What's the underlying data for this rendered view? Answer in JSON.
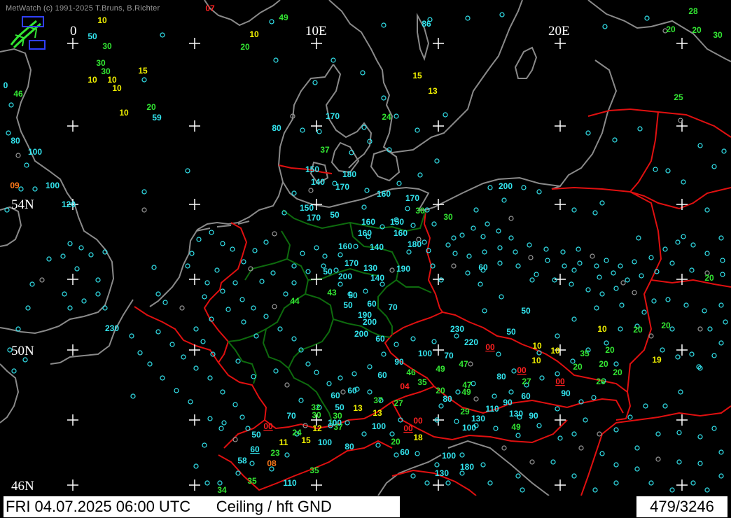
{
  "header": {
    "copyright": "MetWatch  (c) 1991-2025 T.Bruns, B.Richter"
  },
  "footer": {
    "datetime": "FRI 04.07.2025 06:00 UTC",
    "product": "Ceiling / hft GND",
    "count": "479/3246"
  },
  "colors": {
    "cyan": "#33e6f0",
    "green": "#33e633",
    "yellow": "#f0f000",
    "red": "#ff2020",
    "orange": "#ff7a1a",
    "border_red": "#e01010",
    "state_green": "#0e6b0e",
    "coast": "#8a8a8a"
  },
  "grid_labels": {
    "lon": [
      "0",
      "10E",
      "20E"
    ],
    "lat": [
      "54N",
      "50N",
      "46N"
    ]
  },
  "stations": [
    {
      "v": "07",
      "c": "red",
      "u": false
    },
    {
      "v": "49",
      "c": "green"
    },
    {
      "v": "10",
      "c": "yellow"
    },
    {
      "v": "86",
      "c": "cyan"
    },
    {
      "v": "28",
      "c": "green"
    },
    {
      "v": "50",
      "c": "cyan"
    },
    {
      "v": "30",
      "c": "green"
    },
    {
      "v": "10",
      "c": "yellow"
    },
    {
      "v": "20",
      "c": "green"
    },
    {
      "v": "20",
      "c": "green"
    },
    {
      "v": "20",
      "c": "green"
    },
    {
      "v": "30",
      "c": "green"
    },
    {
      "v": "30",
      "c": "green"
    },
    {
      "v": "30",
      "c": "green"
    },
    {
      "v": "15",
      "c": "yellow"
    },
    {
      "v": "10",
      "c": "yellow"
    },
    {
      "v": "10",
      "c": "yellow"
    },
    {
      "v": "10",
      "c": "yellow"
    },
    {
      "v": "15",
      "c": "yellow"
    },
    {
      "v": "13",
      "c": "yellow"
    },
    {
      "v": "0",
      "c": "cyan"
    },
    {
      "v": "46",
      "c": "green"
    },
    {
      "v": "25",
      "c": "green"
    },
    {
      "v": "20",
      "c": "green"
    },
    {
      "v": "10",
      "c": "yellow"
    },
    {
      "v": "59",
      "c": "cyan"
    },
    {
      "v": "170",
      "c": "cyan"
    },
    {
      "v": "24",
      "c": "green"
    },
    {
      "v": "80",
      "c": "cyan"
    },
    {
      "v": "80",
      "c": "cyan"
    },
    {
      "v": "100",
      "c": "cyan"
    },
    {
      "v": "37",
      "c": "green"
    },
    {
      "v": "150",
      "c": "cyan"
    },
    {
      "v": "180",
      "c": "cyan"
    },
    {
      "v": "140",
      "c": "cyan"
    },
    {
      "v": "170",
      "c": "cyan"
    },
    {
      "v": "09",
      "c": "orange"
    },
    {
      "v": "100",
      "c": "cyan"
    },
    {
      "v": "160",
      "c": "cyan"
    },
    {
      "v": "170",
      "c": "cyan"
    },
    {
      "v": "200",
      "c": "cyan"
    },
    {
      "v": "120",
      "c": "cyan"
    },
    {
      "v": "150",
      "c": "cyan"
    },
    {
      "v": "30",
      "c": "green"
    },
    {
      "v": "170",
      "c": "cyan"
    },
    {
      "v": "50",
      "c": "cyan"
    },
    {
      "v": "30",
      "c": "green"
    },
    {
      "v": "160",
      "c": "cyan"
    },
    {
      "v": "150",
      "c": "cyan"
    },
    {
      "v": "160",
      "c": "cyan"
    },
    {
      "v": "160",
      "c": "cyan"
    },
    {
      "v": "180",
      "c": "cyan"
    },
    {
      "v": "160",
      "c": "cyan"
    },
    {
      "v": "140",
      "c": "cyan"
    },
    {
      "v": "170",
      "c": "cyan"
    },
    {
      "v": "50",
      "c": "cyan"
    },
    {
      "v": "130",
      "c": "cyan"
    },
    {
      "v": "190",
      "c": "cyan"
    },
    {
      "v": "200",
      "c": "cyan"
    },
    {
      "v": "140",
      "c": "cyan"
    },
    {
      "v": "60",
      "c": "cyan"
    },
    {
      "v": "20",
      "c": "green"
    },
    {
      "v": "43",
      "c": "green"
    },
    {
      "v": "44",
      "c": "green"
    },
    {
      "v": "50",
      "c": "cyan"
    },
    {
      "v": "60",
      "c": "cyan"
    },
    {
      "v": "70",
      "c": "cyan"
    },
    {
      "v": "50",
      "c": "cyan"
    },
    {
      "v": "190",
      "c": "cyan"
    },
    {
      "v": "200",
      "c": "cyan"
    },
    {
      "v": "230",
      "c": "cyan"
    },
    {
      "v": "230",
      "c": "cyan"
    },
    {
      "v": "10",
      "c": "yellow"
    },
    {
      "v": "20",
      "c": "green"
    },
    {
      "v": "20",
      "c": "green"
    },
    {
      "v": "200",
      "c": "cyan"
    },
    {
      "v": "60",
      "c": "cyan"
    },
    {
      "v": "220",
      "c": "cyan"
    },
    {
      "v": "50",
      "c": "cyan"
    },
    {
      "v": "00",
      "c": "red",
      "u": true
    },
    {
      "v": "10",
      "c": "yellow"
    },
    {
      "v": "10",
      "c": "yellow"
    },
    {
      "v": "35",
      "c": "green"
    },
    {
      "v": "20",
      "c": "green"
    },
    {
      "v": "100",
      "c": "cyan"
    },
    {
      "v": "70",
      "c": "cyan"
    },
    {
      "v": "90",
      "c": "cyan"
    },
    {
      "v": "47",
      "c": "green"
    },
    {
      "v": "10",
      "c": "yellow"
    },
    {
      "v": "19",
      "c": "yellow"
    },
    {
      "v": "46",
      "c": "green"
    },
    {
      "v": "49",
      "c": "green"
    },
    {
      "v": "00",
      "c": "red",
      "u": true
    },
    {
      "v": "20",
      "c": "green"
    },
    {
      "v": "20",
      "c": "green"
    },
    {
      "v": "20",
      "c": "green"
    },
    {
      "v": "60",
      "c": "cyan"
    },
    {
      "v": "35",
      "c": "green"
    },
    {
      "v": "80",
      "c": "cyan"
    },
    {
      "v": "27",
      "c": "green"
    },
    {
      "v": "00",
      "c": "red",
      "u": true
    },
    {
      "v": "26",
      "c": "green"
    },
    {
      "v": "04",
      "c": "red"
    },
    {
      "v": "47",
      "c": "green"
    },
    {
      "v": "60",
      "c": "cyan"
    },
    {
      "v": "60",
      "c": "cyan"
    },
    {
      "v": "20",
      "c": "green"
    },
    {
      "v": "49",
      "c": "green"
    },
    {
      "v": "90",
      "c": "cyan"
    },
    {
      "v": "60",
      "c": "cyan"
    },
    {
      "v": "37",
      "c": "green"
    },
    {
      "v": "80",
      "c": "cyan"
    },
    {
      "v": "90",
      "c": "cyan"
    },
    {
      "v": "27",
      "c": "green"
    },
    {
      "v": "32",
      "c": "green"
    },
    {
      "v": "50",
      "c": "cyan"
    },
    {
      "v": "13",
      "c": "yellow"
    },
    {
      "v": "13",
      "c": "yellow"
    },
    {
      "v": "29",
      "c": "green"
    },
    {
      "v": "110",
      "c": "cyan"
    },
    {
      "v": "70",
      "c": "cyan"
    },
    {
      "v": "30",
      "c": "green"
    },
    {
      "v": "30",
      "c": "green"
    },
    {
      "v": "130",
      "c": "cyan"
    },
    {
      "v": "90",
      "c": "cyan"
    },
    {
      "v": "130",
      "c": "cyan"
    },
    {
      "v": "00",
      "c": "red",
      "u": true
    },
    {
      "v": "12",
      "c": "yellow"
    },
    {
      "v": "37",
      "c": "green"
    },
    {
      "v": "100",
      "c": "cyan"
    },
    {
      "v": "00",
      "c": "red"
    },
    {
      "v": "00",
      "c": "red",
      "u": true
    },
    {
      "v": "100",
      "c": "cyan"
    },
    {
      "v": "49",
      "c": "green"
    },
    {
      "v": "50",
      "c": "cyan"
    },
    {
      "v": "24",
      "c": "green"
    },
    {
      "v": "11",
      "c": "yellow"
    },
    {
      "v": "15",
      "c": "yellow"
    },
    {
      "v": "100",
      "c": "cyan"
    },
    {
      "v": "80",
      "c": "cyan"
    },
    {
      "v": "18",
      "c": "yellow"
    },
    {
      "v": "60",
      "c": "cyan",
      "u": true
    },
    {
      "v": "23",
      "c": "green"
    },
    {
      "v": "20",
      "c": "green"
    },
    {
      "v": "60",
      "c": "cyan"
    },
    {
      "v": "100",
      "c": "cyan"
    },
    {
      "v": "58",
      "c": "cyan"
    },
    {
      "v": "08",
      "c": "orange"
    },
    {
      "v": "180",
      "c": "cyan"
    },
    {
      "v": "35",
      "c": "green"
    },
    {
      "v": "130",
      "c": "cyan"
    },
    {
      "v": "35",
      "c": "green"
    },
    {
      "v": "110",
      "c": "cyan"
    },
    {
      "v": "34",
      "c": "green"
    },
    {
      "v": "50",
      "c": "cyan"
    },
    {
      "v": "100",
      "c": "cyan"
    }
  ]
}
